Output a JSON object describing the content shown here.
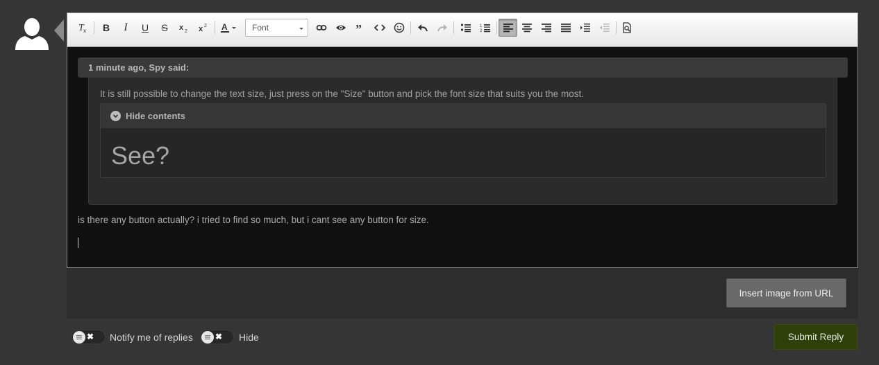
{
  "toolbar": {
    "font_select": {
      "value": "Font"
    },
    "buttons": [
      {
        "name": "remove-format-icon"
      },
      {
        "name": "bold-icon",
        "glyph": "B"
      },
      {
        "name": "italic-icon",
        "glyph": "I"
      },
      {
        "name": "underline-icon",
        "glyph": "U"
      },
      {
        "name": "strikethrough-icon",
        "glyph": "S"
      },
      {
        "name": "subscript-icon"
      },
      {
        "name": "superscript-icon"
      },
      {
        "name": "text-color-icon"
      },
      {
        "name": "link-icon"
      },
      {
        "name": "spoiler-eye-icon"
      },
      {
        "name": "quote-icon"
      },
      {
        "name": "code-icon"
      },
      {
        "name": "emoji-icon"
      },
      {
        "name": "undo-icon"
      },
      {
        "name": "redo-icon"
      },
      {
        "name": "bulleted-list-icon"
      },
      {
        "name": "numbered-list-icon"
      },
      {
        "name": "align-left-icon",
        "active": true
      },
      {
        "name": "align-center-icon"
      },
      {
        "name": "align-right-icon"
      },
      {
        "name": "justify-icon"
      },
      {
        "name": "indent-icon"
      },
      {
        "name": "outdent-icon",
        "disabled": true
      },
      {
        "name": "preview-icon"
      }
    ]
  },
  "quote": {
    "header": "1 minute ago, Spy said:",
    "text": "It is still possible to change the text size, just press on the \"Size\" button and pick the font size that suits you the most.",
    "spoiler": {
      "toggle_label": "Hide contents",
      "content": "See?"
    }
  },
  "reply": {
    "text": "is there any button actually? i tried to find so much, but i cant see any button for size."
  },
  "attachments": {
    "insert_image_label": "Insert image from URL"
  },
  "options": {
    "notify_label": "Notify me of replies",
    "hide_label": "Hide"
  },
  "actions": {
    "submit_label": "Submit Reply"
  },
  "colors": {
    "page_bg": "#353535",
    "editor_bg": "#111111",
    "submit_bg": "#2f3f08"
  }
}
